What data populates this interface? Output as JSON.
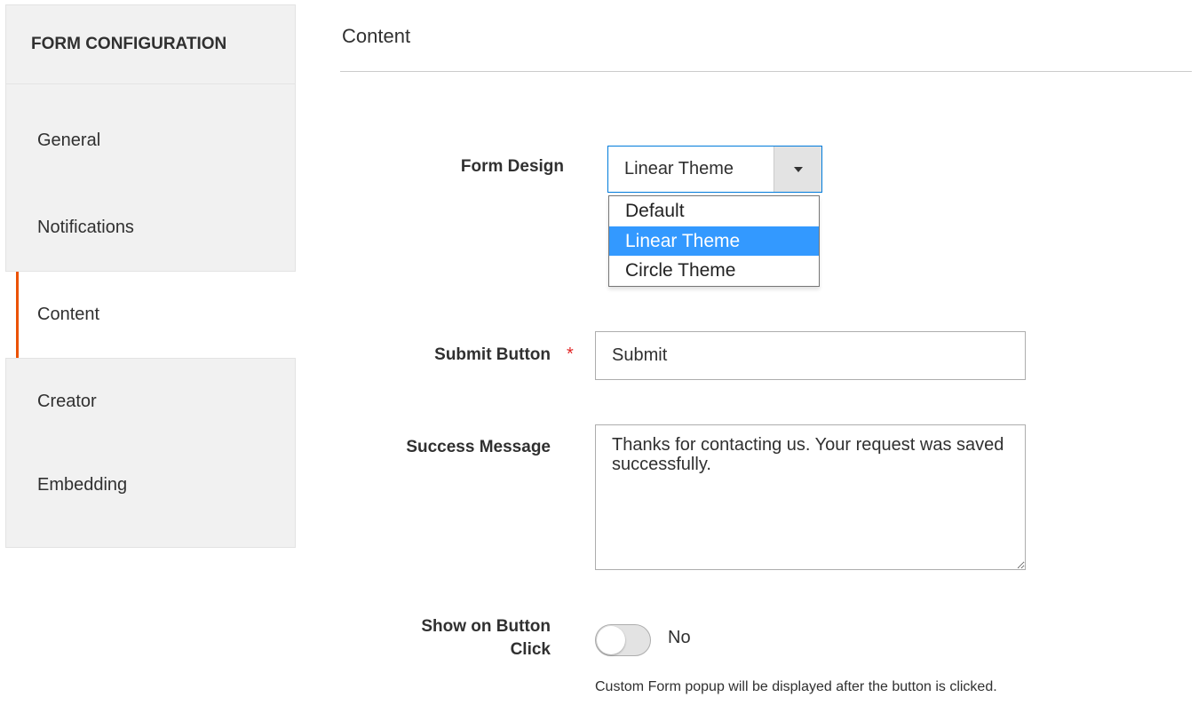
{
  "sidebar": {
    "title": "FORM CONFIGURATION",
    "items": [
      {
        "label": "General",
        "active": false
      },
      {
        "label": "Notifications",
        "active": false
      },
      {
        "label": "Content",
        "active": true
      },
      {
        "label": "Creator",
        "active": false
      },
      {
        "label": "Embedding",
        "active": false
      }
    ]
  },
  "main": {
    "title": "Content",
    "form_design": {
      "label": "Form Design",
      "value": "Linear Theme",
      "options": [
        "Default",
        "Linear Theme",
        "Circle Theme"
      ]
    },
    "submit_button": {
      "label": "Submit Button",
      "required_marker": "*",
      "value": "Submit"
    },
    "success_message": {
      "label": "Success Message",
      "value": "Thanks for contacting us. Your request was saved successfully."
    },
    "show_on_button_click": {
      "label_line1": "Show on Button",
      "label_line2": "Click",
      "value": "No",
      "note": "Custom Form popup will be displayed after the button is clicked."
    }
  },
  "colors": {
    "accent": "#eb5202",
    "select_border": "#007bdb",
    "option_highlight": "#3399ff",
    "required": "#e22626"
  },
  "icons": {
    "select_arrow": "chevron-down-icon"
  }
}
